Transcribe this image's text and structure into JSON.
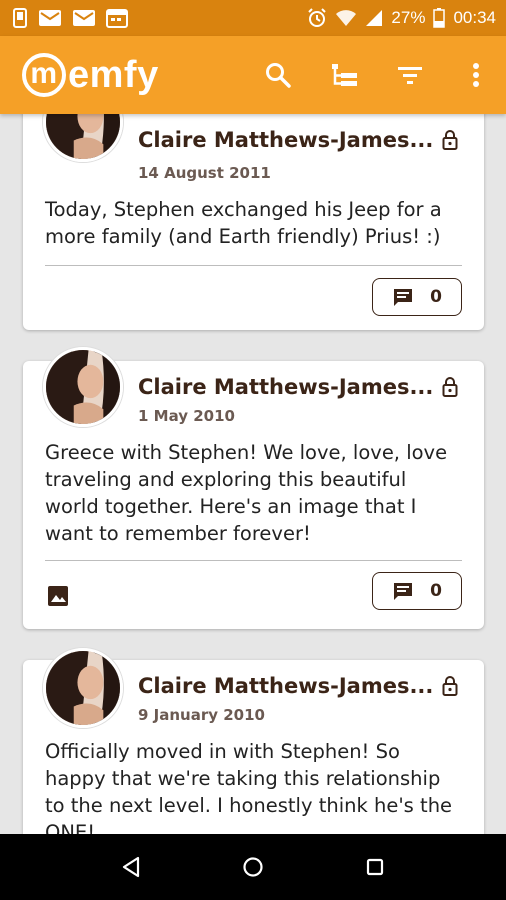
{
  "status_bar": {
    "battery": "27%",
    "time": "00:34",
    "left_icons": [
      "phone-icon",
      "mail-icon",
      "mail-icon",
      "calendar-icon"
    ],
    "right_icons": [
      "alarm-icon",
      "wifi-icon",
      "signal-icon",
      "battery-icon"
    ]
  },
  "app_bar": {
    "logo_text": "emfy",
    "logo_letter": "m",
    "actions": [
      "search-icon",
      "timeline-icon",
      "filter-icon",
      "more-vert-icon"
    ]
  },
  "posts": [
    {
      "author": "Claire Matthews-James...",
      "date": "14 August 2011",
      "text": "Today, Stephen exchanged his Jeep for a more family (and Earth friendly) Prius! :)",
      "comments": "0",
      "has_image": false
    },
    {
      "author": "Claire Matthews-James...",
      "date": "1 May 2010",
      "text": "Greece with Stephen! We love, love, love traveling and exploring this beautiful world together. Here's an image that I want to remember forever!",
      "comments": "0",
      "has_image": true
    },
    {
      "author": "Claire Matthews-James...",
      "date": "9 January 2010",
      "text": "Officially moved in with Stephen! So happy that we're taking this relationship to the next level. I honestly think he's the ONE!",
      "comments": "",
      "has_image": false
    }
  ],
  "colors": {
    "status_bar": "#d9830f",
    "app_bar": "#f5a027",
    "accent_text": "#3b2417",
    "background": "#e6e6e6"
  }
}
